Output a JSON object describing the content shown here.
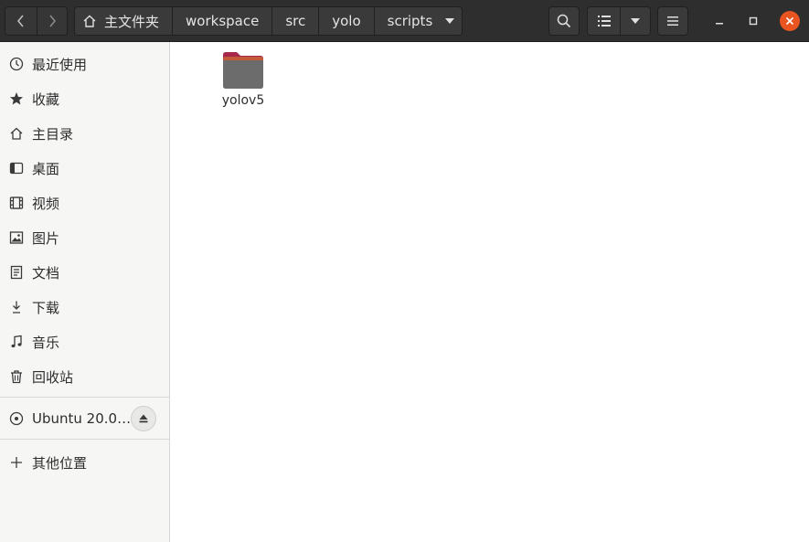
{
  "header": {
    "back_icon": "chevron-left-icon",
    "forward_icon": "chevron-right-icon",
    "breadcrumbs": [
      "主文件夹",
      "workspace",
      "src",
      "yolo",
      "scripts"
    ],
    "search_icon": "search-icon",
    "view_icon": "list-view-icon",
    "view_menu_icon": "chevron-down-icon",
    "menu_icon": "hamburger-icon",
    "accent": "#e95420"
  },
  "sidebar": {
    "items": [
      {
        "label": "最近使用",
        "icon": "clock-icon"
      },
      {
        "label": "收藏",
        "icon": "star-icon"
      },
      {
        "label": "主目录",
        "icon": "home-icon"
      },
      {
        "label": "桌面",
        "icon": "desktop-icon"
      },
      {
        "label": "视频",
        "icon": "film-icon"
      },
      {
        "label": "图片",
        "icon": "image-icon"
      },
      {
        "label": "文档",
        "icon": "document-icon"
      },
      {
        "label": "下载",
        "icon": "download-icon"
      },
      {
        "label": "音乐",
        "icon": "music-icon"
      },
      {
        "label": "回收站",
        "icon": "trash-icon"
      }
    ],
    "volume": {
      "label": "Ubuntu 20.0…",
      "icon": "disc-icon",
      "eject_icon": "eject-icon"
    },
    "other": {
      "label": "其他位置",
      "icon": "plus-icon"
    }
  },
  "files": [
    {
      "name": "yolov5",
      "type": "folder",
      "icon": "folder-icon"
    }
  ]
}
